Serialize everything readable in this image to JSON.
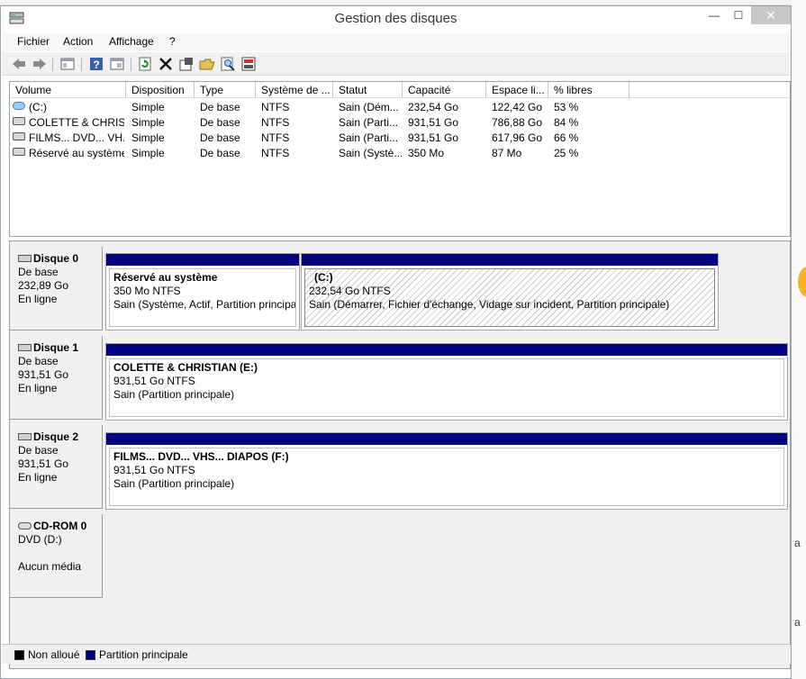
{
  "window": {
    "title": "Gestion des disques",
    "controls": {
      "minimize": "—",
      "maximize": "☐",
      "close": "✕"
    }
  },
  "menu": [
    "Fichier",
    "Action",
    "Affichage",
    "?"
  ],
  "toolbar_icons": [
    "back-arrow-icon",
    "forward-arrow-icon",
    "console-tree-icon",
    "help-icon",
    "properties-icon",
    "refresh-icon",
    "delete-icon",
    "settings-icon",
    "open-folder-icon",
    "search-icon",
    "rescan-icon"
  ],
  "volume_list": {
    "columns": [
      "Volume",
      "Disposition",
      "Type",
      "Système de ...",
      "Statut",
      "Capacité",
      "Espace li...",
      "% libres"
    ],
    "rows": [
      {
        "volume": "(C:)",
        "disposition": "Simple",
        "type": "De base",
        "fs": "NTFS",
        "status": "Sain (Dém...",
        "capacity": "232,54 Go",
        "free": "122,42 Go",
        "pct": "53 %",
        "icon": "system-drive-icon"
      },
      {
        "volume": "COLETTE & CHRIS...",
        "disposition": "Simple",
        "type": "De base",
        "fs": "NTFS",
        "status": "Sain (Parti...",
        "capacity": "931,51 Go",
        "free": "786,88 Go",
        "pct": "84 %",
        "icon": "drive-icon"
      },
      {
        "volume": "FILMS... DVD... VH...",
        "disposition": "Simple",
        "type": "De base",
        "fs": "NTFS",
        "status": "Sain (Parti...",
        "capacity": "931,51 Go",
        "free": "617,96 Go",
        "pct": "66 %",
        "icon": "drive-icon"
      },
      {
        "volume": "Réservé au système",
        "disposition": "Simple",
        "type": "De base",
        "fs": "NTFS",
        "status": "Sain (Systè...",
        "capacity": "350 Mo",
        "free": "87 Mo",
        "pct": "25 %",
        "icon": "drive-icon"
      }
    ]
  },
  "disks": [
    {
      "name": "Disque 0",
      "kind": "De base",
      "size": "232,89 Go",
      "state": "En ligne",
      "partitions": [
        {
          "name": "Réservé au système",
          "size": "350 Mo NTFS",
          "status": "Sain (Système, Actif, Partition principal"
        },
        {
          "name": "(C:)",
          "size": "232,54 Go NTFS",
          "status": "Sain (Démarrer, Fichier d'échange, Vidage sur incident, Partition principale)"
        }
      ]
    },
    {
      "name": "Disque 1",
      "kind": "De base",
      "size": "931,51 Go",
      "state": "En ligne",
      "partitions": [
        {
          "name": "COLETTE & CHRISTIAN  (E:)",
          "size": "931,51 Go NTFS",
          "status": "Sain (Partition principale)"
        }
      ]
    },
    {
      "name": "Disque 2",
      "kind": "De base",
      "size": "931,51 Go",
      "state": "En ligne",
      "partitions": [
        {
          "name": "FILMS... DVD... VHS... DIAPOS  (F:)",
          "size": "931,51 Go NTFS",
          "status": "Sain (Partition principale)"
        }
      ]
    },
    {
      "name": "CD-ROM 0",
      "kind": "DVD (D:)",
      "size": "",
      "state": "Aucun média",
      "partitions": []
    }
  ],
  "legend": {
    "items": [
      {
        "label": "Non alloué",
        "color": "#000000"
      },
      {
        "label": "Partition principale",
        "color": "#00007f"
      }
    ]
  },
  "colors": {
    "primary_partition_bar": "#00007f",
    "unallocated": "#000000"
  },
  "background": {
    "right_letters": [
      "a",
      "a"
    ]
  }
}
